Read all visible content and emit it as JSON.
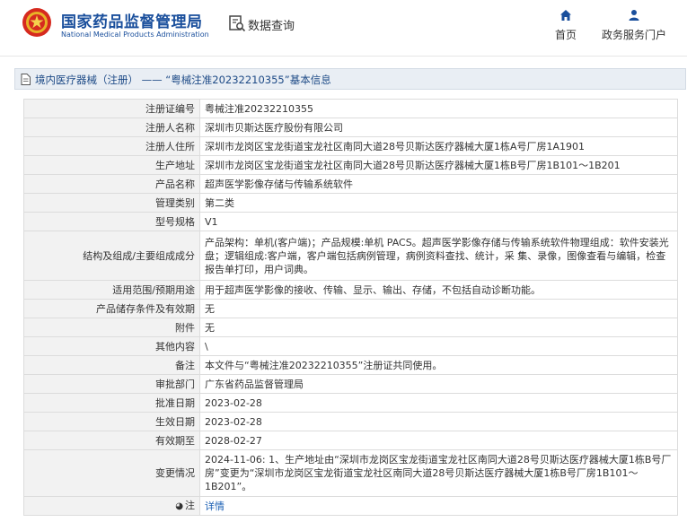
{
  "header": {
    "site_name_cn": "国家药品监督管理局",
    "site_name_en": "National Medical Products Administration",
    "data_query_label": "数据查询",
    "nav": [
      {
        "label": "首页",
        "icon": "home-icon"
      },
      {
        "label": "政务服务门户",
        "icon": "user-icon"
      }
    ]
  },
  "page": {
    "title": "境内医疗器械（注册） —— “粤械注准20232210355”基本信息"
  },
  "details": [
    {
      "key": "注册证编号",
      "value": "粤械注准20232210355"
    },
    {
      "key": "注册人名称",
      "value": "深圳市贝斯达医疗股份有限公司"
    },
    {
      "key": "注册人住所",
      "value": "深圳市龙岗区宝龙街道宝龙社区南同大道28号贝斯达医疗器械大厦1栋A号厂房1A1901"
    },
    {
      "key": "生产地址",
      "value": "深圳市龙岗区宝龙街道宝龙社区南同大道28号贝斯达医疗器械大厦1栋B号厂房1B101～1B201"
    },
    {
      "key": "产品名称",
      "value": "超声医学影像存储与传输系统软件"
    },
    {
      "key": "管理类别",
      "value": "第二类"
    },
    {
      "key": "型号规格",
      "value": "V1"
    },
    {
      "key": "结构及组成/主要组成成分",
      "value": "产品架构：单机(客户端)；产品规模:单机 PACS。超声医学影像存储与传输系统软件物理组成：软件安装光盘；逻辑组成:客户端，客户端包括病例管理，病例资料查找、统计，采 集、录像，图像查看与编辑，检查报告单打印，用户词典。"
    },
    {
      "key": "适用范围/预期用途",
      "value": "用于超声医学影像的接收、传输、显示、输出、存储，不包括自动诊断功能。"
    },
    {
      "key": "产品储存条件及有效期",
      "value": "无"
    },
    {
      "key": "附件",
      "value": "无"
    },
    {
      "key": "其他内容",
      "value": "\\"
    },
    {
      "key": "备注",
      "value": "本文件与“粤械注准20232210355”注册证共同使用。"
    },
    {
      "key": "审批部门",
      "value": "广东省药品监督管理局"
    },
    {
      "key": "批准日期",
      "value": "2023-02-28"
    },
    {
      "key": "生效日期",
      "value": "2023-02-28"
    },
    {
      "key": "有效期至",
      "value": "2028-02-27"
    },
    {
      "key": "变更情况",
      "value": "2024-11-06: 1、生产地址由“深圳市龙岗区宝龙街道宝龙社区南同大道28号贝斯达医疗器械大厦1栋B号厂房”变更为“深圳市龙岗区宝龙街道宝龙社区南同大道28号贝斯达医疗器械大厦1栋B号厂房1B101～1B201”。"
    }
  ],
  "note": {
    "key": "注",
    "value": "详情",
    "icon": "info-icon"
  }
}
